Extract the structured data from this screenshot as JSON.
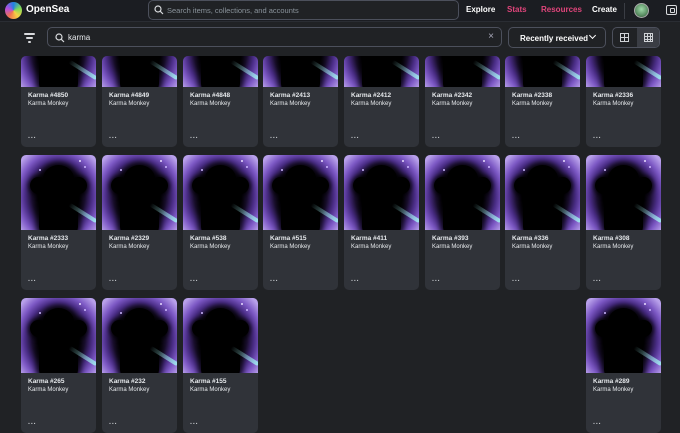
{
  "header": {
    "brand": "OpenSea",
    "search_placeholder": "Search items, collections, and accounts",
    "nav": [
      {
        "label": "Explore",
        "color": "#ffffff"
      },
      {
        "label": "Stats",
        "color": "#e0457b"
      },
      {
        "label": "Resources",
        "color": "#e0457b"
      },
      {
        "label": "Create",
        "color": "#ffffff"
      }
    ]
  },
  "toolbar": {
    "search_value": "karma",
    "clear_glyph": "×",
    "sort_label": "Recently received"
  },
  "grid": {
    "more_label": "···",
    "rows": [
      [
        {
          "title": "Karma #4850",
          "collection": "Karma Monkey"
        },
        {
          "title": "Karma #4849",
          "collection": "Karma Monkey"
        },
        {
          "title": "Karma #4848",
          "collection": "Karma Monkey"
        },
        {
          "title": "Karma #2413",
          "collection": "Karma Monkey"
        },
        {
          "title": "Karma #2412",
          "collection": "Karma Monkey"
        },
        {
          "title": "Karma #2342",
          "collection": "Karma Monkey"
        },
        {
          "title": "Karma #2338",
          "collection": "Karma Monkey"
        },
        {
          "title": "Karma #2336",
          "collection": "Karma Monkey"
        }
      ],
      [
        {
          "title": "Karma #2333",
          "collection": "Karma Monkey"
        },
        {
          "title": "Karma #2329",
          "collection": "Karma Monkey"
        },
        {
          "title": "Karma #538",
          "collection": "Karma Monkey"
        },
        {
          "title": "Karma #515",
          "collection": "Karma Monkey"
        },
        {
          "title": "Karma #411",
          "collection": "Karma Monkey"
        },
        {
          "title": "Karma #393",
          "collection": "Karma Monkey"
        },
        {
          "title": "Karma #336",
          "collection": "Karma Monkey"
        },
        {
          "title": "Karma #308",
          "collection": "Karma Monkey"
        }
      ],
      [
        {
          "title": "Karma #265",
          "collection": "Karma Monkey"
        },
        {
          "title": "Karma #232",
          "collection": "Karma Monkey"
        },
        {
          "title": "Karma #155",
          "collection": "Karma Monkey"
        },
        null,
        null,
        null,
        null,
        {
          "title": "Karma #289",
          "collection": "Karma Monkey"
        }
      ]
    ]
  }
}
